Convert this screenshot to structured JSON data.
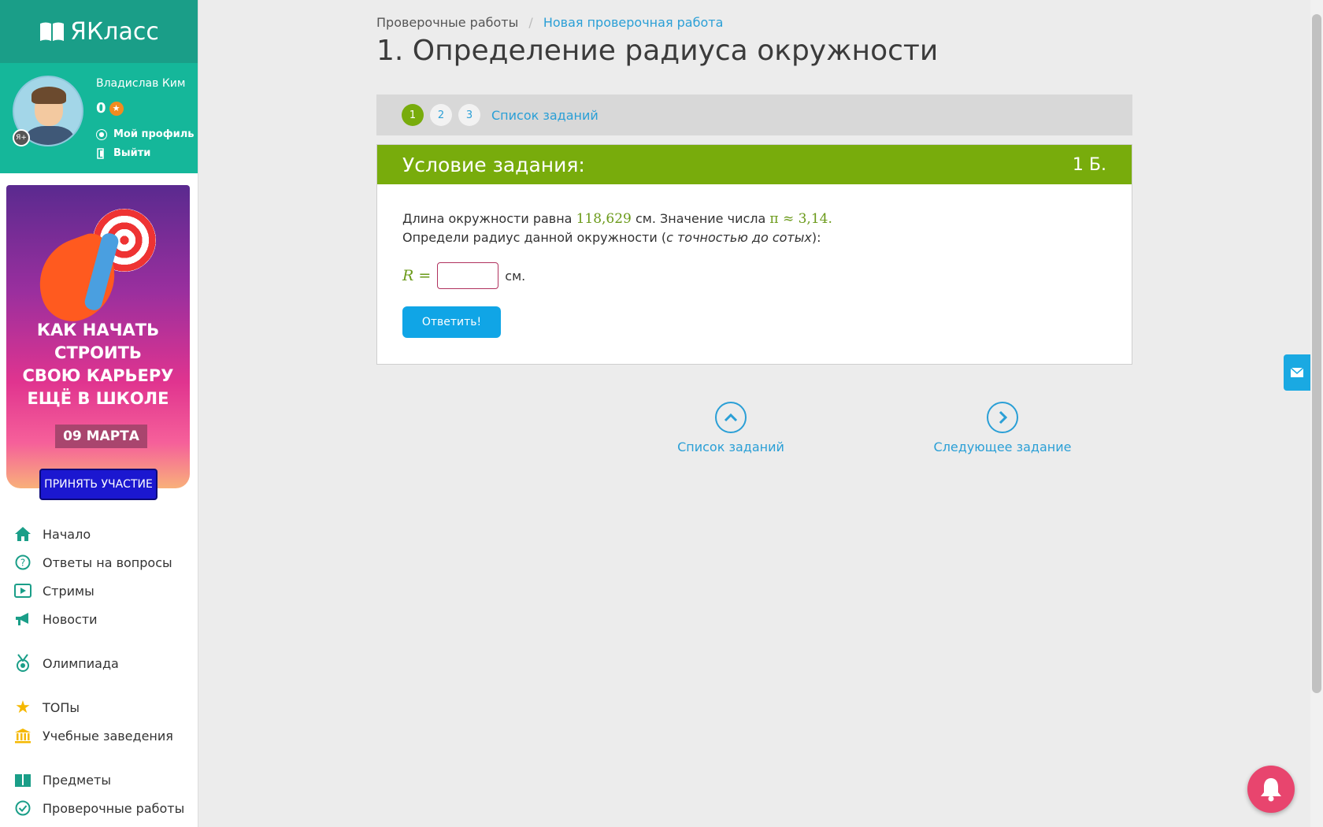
{
  "brand": {
    "name": "ЯКласс"
  },
  "user": {
    "name": "Владислав Ким",
    "score": "0",
    "profile_link": "Мой профиль",
    "logout_link": "Выйти",
    "badge": "Я+"
  },
  "ad": {
    "line1": "КАК НАЧАТЬ",
    "line2": "СТРОИТЬ",
    "line3": "СВОЮ КАРЬЕРУ",
    "line4": "ЕЩЁ В ШКОЛЕ",
    "date": "09 МАРТА",
    "button": "ПРИНЯТЬ УЧАСТИЕ"
  },
  "nav": [
    {
      "label": "Начало",
      "icon": "home-icon"
    },
    {
      "label": "Ответы на вопросы",
      "icon": "question-icon"
    },
    {
      "label": "Стримы",
      "icon": "play-icon"
    },
    {
      "label": "Новости",
      "icon": "megaphone-icon"
    },
    {
      "label": "Олимпиада",
      "icon": "medal-icon"
    },
    {
      "label": "ТОПы",
      "icon": "star-icon"
    },
    {
      "label": "Учебные заведения",
      "icon": "institution-icon"
    },
    {
      "label": "Предметы",
      "icon": "books-icon"
    },
    {
      "label": "Проверочные работы",
      "icon": "check-circle-icon"
    }
  ],
  "breadcrumb": {
    "item1": "Проверочные работы",
    "separator": "/",
    "item2": "Новая проверочная работа"
  },
  "page_title": "1. Определение радиуса окружности",
  "steps": {
    "items": [
      "1",
      "2",
      "3"
    ],
    "active": "1",
    "list_link": "Список заданий"
  },
  "task": {
    "header": "Условие задания:",
    "points": "1 Б.",
    "text1_a": "Длина окружности равна ",
    "text1_num": "118,629",
    "text1_b": " см. Значение числа ",
    "text1_pi": "π ≈ 3,14.",
    "text2_a": "Определи радиус данной окружности (",
    "text2_em": "с точностью до сотых",
    "text2_b": "):",
    "answer_var": "R =",
    "answer_value": "",
    "answer_unit": "см.",
    "submit": "Ответить!"
  },
  "bottom_nav": {
    "list": "Список заданий",
    "next": "Следующее задание"
  },
  "colors": {
    "teal": "#1a9e88",
    "green": "#78ac0c",
    "blue_link": "#2a9fd6",
    "button_blue": "#10a5e6",
    "bell_pink": "#e8456e"
  }
}
